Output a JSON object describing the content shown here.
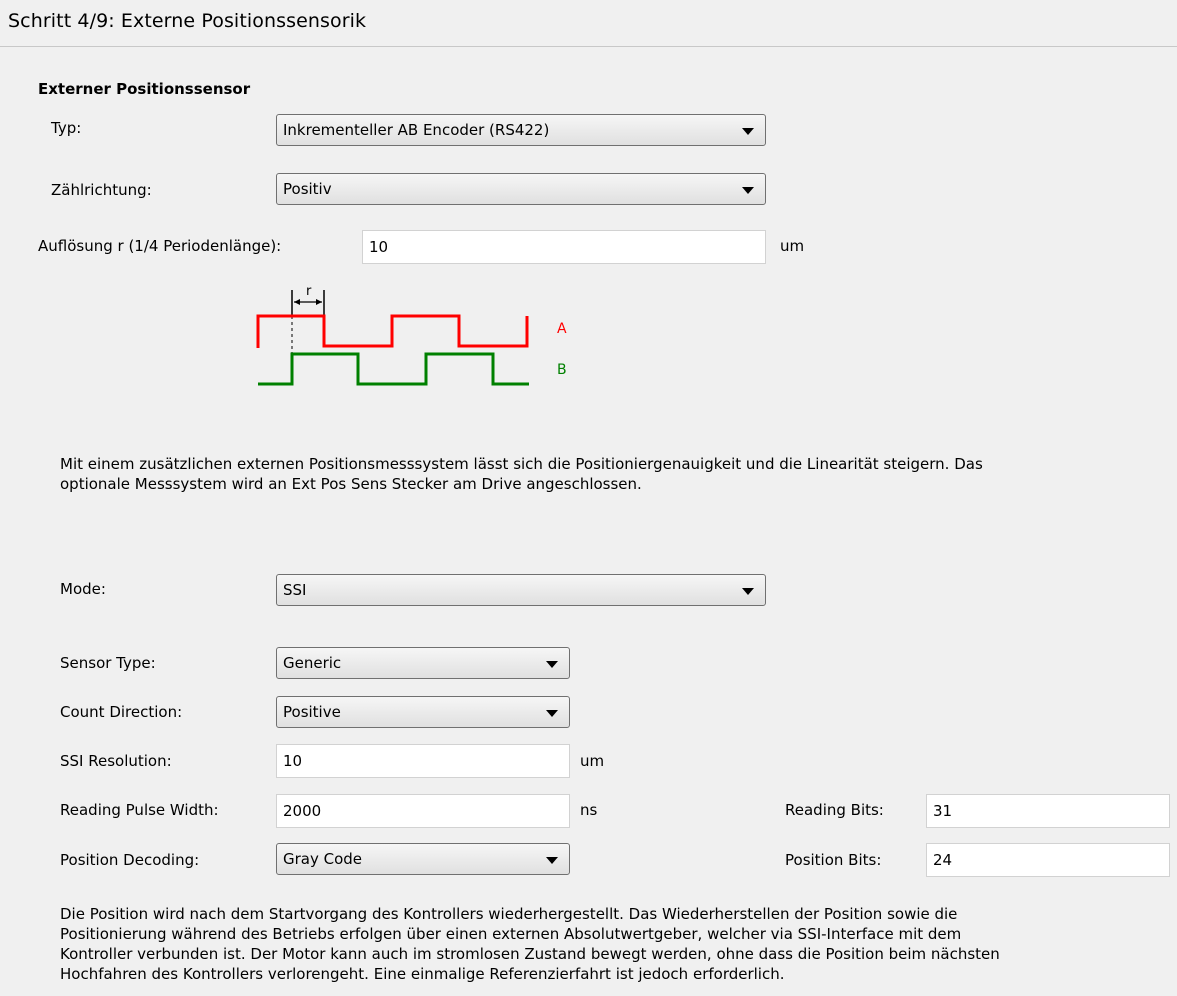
{
  "header": {
    "title": "Schritt 4/9: Externe Positionssensorik"
  },
  "section_title": "Externer Positionssensor",
  "typ": {
    "label": "Typ:",
    "value": "Inkrementeller AB Encoder (RS422)"
  },
  "zaehlrichtung": {
    "label": "Zählrichtung:",
    "value": "Positiv"
  },
  "aufloesung": {
    "label": "Auflösung r (1/4 Periodenlänge):",
    "value": "10",
    "unit": "um"
  },
  "diagram": {
    "r_label": "r",
    "a_label": "A",
    "b_label": "B",
    "colors": {
      "a": "#ff0000",
      "b": "#008000"
    }
  },
  "info_text": {
    "line1": "Mit einem zusätzlichen externen Positionsmesssystem lässt sich die Positioniergenauigkeit und die Linearität steigern. Das",
    "line2": "optionale Messsystem wird an Ext Pos Sens Stecker am Drive angeschlossen."
  },
  "mode": {
    "label": "Mode:",
    "value": "SSI"
  },
  "sensor_type": {
    "label": "Sensor Type:",
    "value": "Generic"
  },
  "count_direction": {
    "label": "Count Direction:",
    "value": "Positive"
  },
  "ssi_resolution": {
    "label": "SSI Resolution:",
    "value": "10",
    "unit": "um"
  },
  "reading_pulse_width": {
    "label": "Reading Pulse Width:",
    "value": "2000",
    "unit": "ns"
  },
  "reading_bits": {
    "label": "Reading Bits:",
    "value": "31"
  },
  "position_decoding": {
    "label": "Position Decoding:",
    "value": "Gray Code"
  },
  "position_bits": {
    "label": "Position Bits:",
    "value": "24"
  },
  "bottom_text": {
    "line1": "Die Position wird nach dem Startvorgang des Kontrollers wiederhergestellt. Das Wiederherstellen der Position sowie die",
    "line2": "Positionierung während des Betriebs erfolgen über einen externen Absolutwertgeber, welcher via SSI-Interface mit dem",
    "line3": "Kontroller verbunden ist. Der Motor kann auch im stromlosen Zustand bewegt werden, ohne dass die Position beim nächsten",
    "line4": "Hochfahren des Kontrollers verlorengeht. Eine einmalige Referenzierfahrt ist jedoch erforderlich."
  }
}
